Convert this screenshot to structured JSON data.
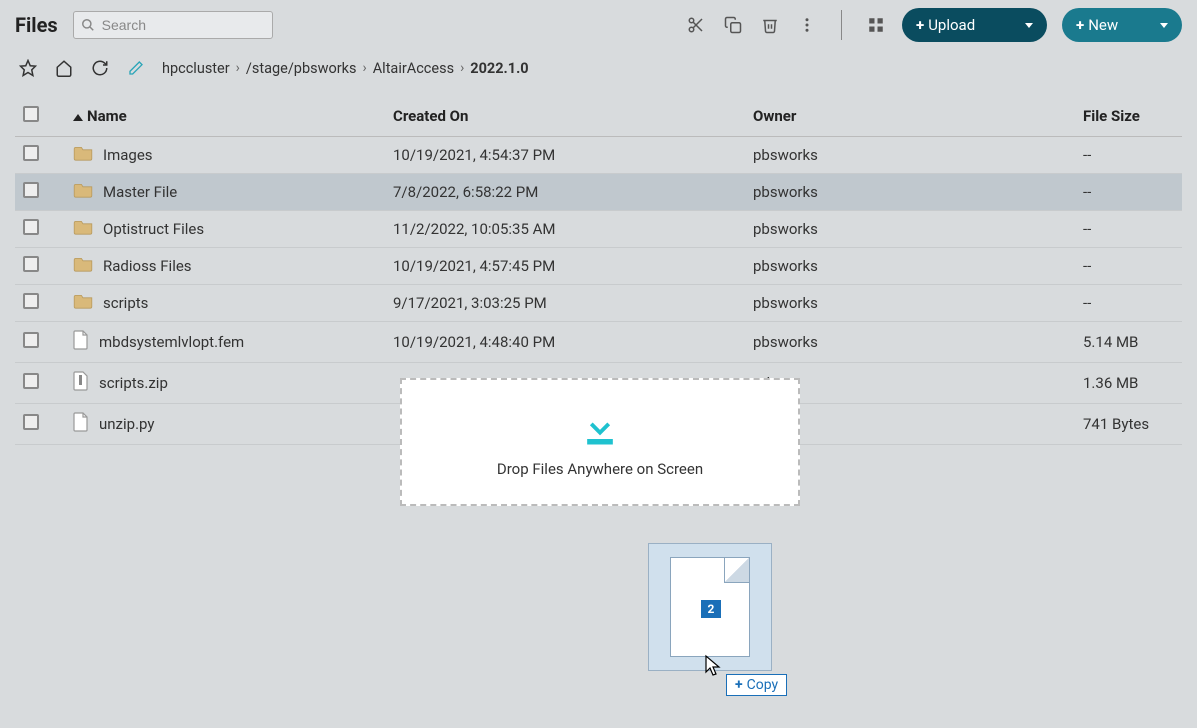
{
  "header": {
    "title": "Files",
    "search_placeholder": "Search",
    "upload_label": "Upload",
    "new_label": "New"
  },
  "breadcrumb": {
    "items": [
      "hpccluster",
      "/stage/pbsworks",
      "AltairAccess",
      "2022.1.0"
    ]
  },
  "table": {
    "columns": {
      "name": "Name",
      "created": "Created On",
      "owner": "Owner",
      "size": "File Size"
    },
    "rows": [
      {
        "type": "folder",
        "name": "Images",
        "created": "10/19/2021, 4:54:37 PM",
        "owner": "pbsworks",
        "size": "--"
      },
      {
        "type": "folder",
        "name": "Master File",
        "created": "7/8/2022, 6:58:22 PM",
        "owner": "pbsworks",
        "size": "--",
        "highlight": true
      },
      {
        "type": "folder",
        "name": "Optistruct Files",
        "created": "11/2/2022, 10:05:35 AM",
        "owner": "pbsworks",
        "size": "--"
      },
      {
        "type": "folder",
        "name": "Radioss Files",
        "created": "10/19/2021, 4:57:45 PM",
        "owner": "pbsworks",
        "size": "--"
      },
      {
        "type": "folder",
        "name": "scripts",
        "created": "9/17/2021, 3:03:25 PM",
        "owner": "pbsworks",
        "size": "--"
      },
      {
        "type": "file",
        "name": "mbdsystemlvlopt.fem",
        "created": "10/19/2021, 4:48:40 PM",
        "owner": "pbsworks",
        "size": "5.14 MB"
      },
      {
        "type": "zip",
        "name": "scripts.zip",
        "created": "",
        "owner": "orks",
        "size": "1.36 MB"
      },
      {
        "type": "file",
        "name": "unzip.py",
        "created": "",
        "owner": "orks",
        "size": "741 Bytes"
      }
    ]
  },
  "dropzone": {
    "text": "Drop Files Anywhere on Screen"
  },
  "drag": {
    "count": "2",
    "tooltip": "Copy"
  }
}
